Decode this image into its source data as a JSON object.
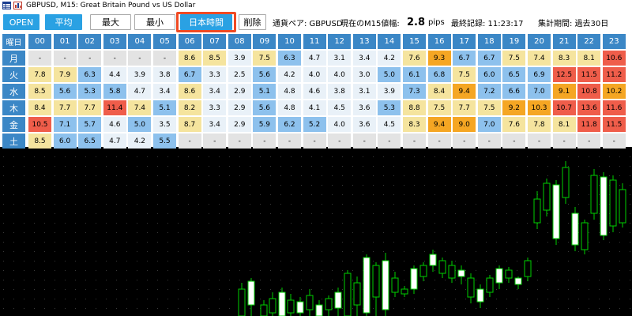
{
  "window": {
    "title": "GBPUSD, M15:  Great Britain Pound vs US Dollar"
  },
  "toolbar": {
    "open_label": "OPEN",
    "avg_label": "平均",
    "max_label": "最大",
    "min_label": "最小",
    "jst_label": "日本時間",
    "delete_label": "削除",
    "pair_label": "通貨ペア: GBPUSD",
    "range_label": "現在のM15値幅:",
    "range_value": "2.8",
    "range_unit": "pips",
    "last_record": "最終記録: 11:23:17",
    "period": "集計期間: 過去30日"
  },
  "table": {
    "corner_label": "曜日",
    "hours": [
      "00",
      "01",
      "02",
      "03",
      "04",
      "05",
      "06",
      "07",
      "08",
      "09",
      "10",
      "11",
      "12",
      "13",
      "14",
      "15",
      "16",
      "17",
      "18",
      "19",
      "20",
      "21",
      "22",
      "23"
    ],
    "rows": [
      {
        "day": "月",
        "values": [
          "-",
          "-",
          "-",
          "-",
          "-",
          "-",
          "8.6",
          "8.5",
          "3.9",
          "7.5",
          "6.3",
          "4.7",
          "3.1",
          "3.4",
          "4.2",
          "7.6",
          "9.3",
          "6.7",
          "6.7",
          "7.5",
          "7.4",
          "8.3",
          "8.1",
          "10.6"
        ]
      },
      {
        "day": "火",
        "values": [
          "7.8",
          "7.9",
          "6.3",
          "4.4",
          "3.9",
          "3.8",
          "6.7",
          "3.3",
          "2.5",
          "5.6",
          "4.2",
          "4.0",
          "4.0",
          "3.0",
          "5.0",
          "6.1",
          "6.8",
          "7.5",
          "6.0",
          "6.5",
          "6.9",
          "12.5",
          "11.5",
          "11.2"
        ]
      },
      {
        "day": "水",
        "values": [
          "8.5",
          "5.6",
          "5.3",
          "5.8",
          "4.7",
          "3.4",
          "8.6",
          "3.4",
          "2.9",
          "5.1",
          "4.8",
          "4.6",
          "3.8",
          "3.1",
          "3.9",
          "7.3",
          "8.4",
          "9.4",
          "7.2",
          "6.6",
          "7.0",
          "9.1",
          "10.8",
          "10.2"
        ]
      },
      {
        "day": "木",
        "values": [
          "8.4",
          "7.7",
          "7.7",
          "11.4",
          "7.4",
          "5.1",
          "8.2",
          "3.3",
          "2.9",
          "5.6",
          "4.8",
          "4.1",
          "4.5",
          "3.6",
          "5.3",
          "8.8",
          "7.5",
          "7.7",
          "7.5",
          "9.2",
          "10.3",
          "10.7",
          "13.6",
          "11.6"
        ]
      },
      {
        "day": "金",
        "values": [
          "10.5",
          "7.1",
          "5.7",
          "4.6",
          "5.0",
          "3.5",
          "8.7",
          "3.4",
          "2.9",
          "5.9",
          "6.2",
          "5.2",
          "4.0",
          "3.6",
          "4.5",
          "8.3",
          "9.4",
          "9.0",
          "7.0",
          "7.6",
          "7.8",
          "8.1",
          "11.8",
          "11.5"
        ]
      },
      {
        "day": "土",
        "values": [
          "8.5",
          "6.0",
          "6.5",
          "4.7",
          "4.2",
          "5.5",
          "-",
          "-",
          "-",
          "-",
          "-",
          "-",
          "-",
          "-",
          "-",
          "-",
          "-",
          "-",
          "-",
          "-",
          "-",
          "-",
          "-",
          "-"
        ]
      }
    ]
  },
  "colors": {
    "header_blue": "#3b87c6",
    "button_blue": "#2aa1e3",
    "highlight_border": "#f04a23",
    "cell_blue": "#8dc1ed",
    "cell_light": "#e9f1f8",
    "cell_yellow": "#f5e49e",
    "cell_orange": "#f5a623",
    "cell_red": "#ef5d4a",
    "cell_grey": "#e3e3e3",
    "candle_green": "#00d000",
    "candle_white": "#ffffff"
  },
  "icons": {
    "title_icon_1": "table-icon",
    "title_icon_2": "chart-icon"
  },
  "chart_data": {
    "type": "candlestick",
    "title": "",
    "candles": []
  }
}
